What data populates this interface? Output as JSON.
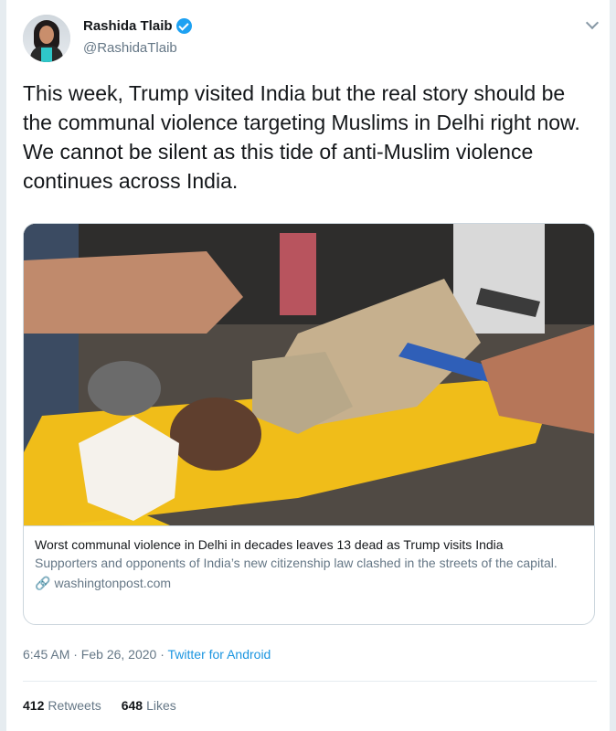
{
  "user": {
    "name": "Rashida Tlaib",
    "handle": "@RashidaTlaib"
  },
  "tweet": {
    "text": "This week, Trump visited India but the real story should be the communal violence targeting Muslims in Delhi right now. We cannot be silent as this tide of anti-Muslim violence continues across India.",
    "timestamp": "6:45 AM · Feb 26, 2020 · ",
    "app": "Twitter for Android"
  },
  "card": {
    "title": "Worst communal violence in Delhi in decades leaves 13 dead as Trump visits India",
    "description": "Supporters and opponents of India’s new citizenship law clashed in the streets of the capital.",
    "domain": "washingtonpost.com",
    "link_icon": "🔗"
  },
  "stats": {
    "retweets_count": "412",
    "retweets_label": "Retweets",
    "likes_count": "648",
    "likes_label": "Likes"
  },
  "colors": {
    "accent": "#1da1f2",
    "link": "#1b95e0",
    "secondary_text": "#657786"
  },
  "icons": {
    "verified": "verified-badge-icon",
    "caret": "chevron-down-icon",
    "link": "link-icon"
  }
}
